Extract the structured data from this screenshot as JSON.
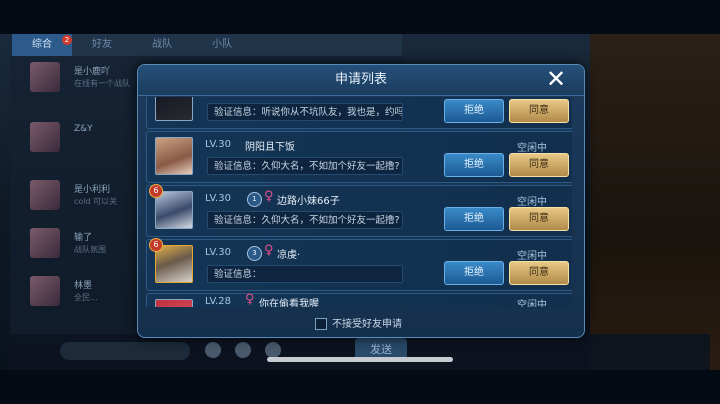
{
  "background": {
    "tabs": [
      {
        "label": "综合",
        "active": true
      },
      {
        "label": "好友",
        "active": false
      },
      {
        "label": "战队",
        "active": false
      },
      {
        "label": "小队",
        "active": false
      }
    ],
    "tab_badge": "2",
    "rows": [
      {
        "name": "是小鹿吖",
        "text": "在线有一个战队"
      },
      {
        "name": "Z&Y",
        "text": ""
      },
      {
        "name": "是小利利",
        "text": "cold 可以关"
      },
      {
        "name": "输了",
        "text": "战队氛围"
      },
      {
        "name": "林墨",
        "text": "全民..."
      }
    ],
    "send_label": "发送"
  },
  "modal": {
    "title": "申请列表",
    "close_symbol": "✕",
    "reject_label": "拒绝",
    "accept_label": "同意",
    "female_symbol": "♀",
    "requests": [
      {
        "level": "",
        "name": "",
        "status": "",
        "message": "验证信息：听说你从不坑队友，我也是，约吗",
        "tier": "",
        "rank": ""
      },
      {
        "level": "LV.30",
        "name": "阴阳且下饭",
        "status": "空闲中",
        "message": "验证信息：久仰大名，不如加个好友一起撸?",
        "tier": "",
        "rank": ""
      },
      {
        "level": "LV.30",
        "name": "边路小妹66子",
        "status": "空闲中",
        "message": "验证信息：久仰大名，不如加个好友一起撸?",
        "tier": "1",
        "rank": "6"
      },
      {
        "level": "LV.30",
        "name": "凉虔·",
        "status": "空闲中",
        "message": "验证信息：",
        "tier": "3",
        "rank": "6"
      },
      {
        "level": "LV.28",
        "name": "你在偷看我喔",
        "status": "空闲中",
        "message": "",
        "tier": "",
        "rank": ""
      }
    ],
    "footer_label": "不接受好友申请"
  }
}
